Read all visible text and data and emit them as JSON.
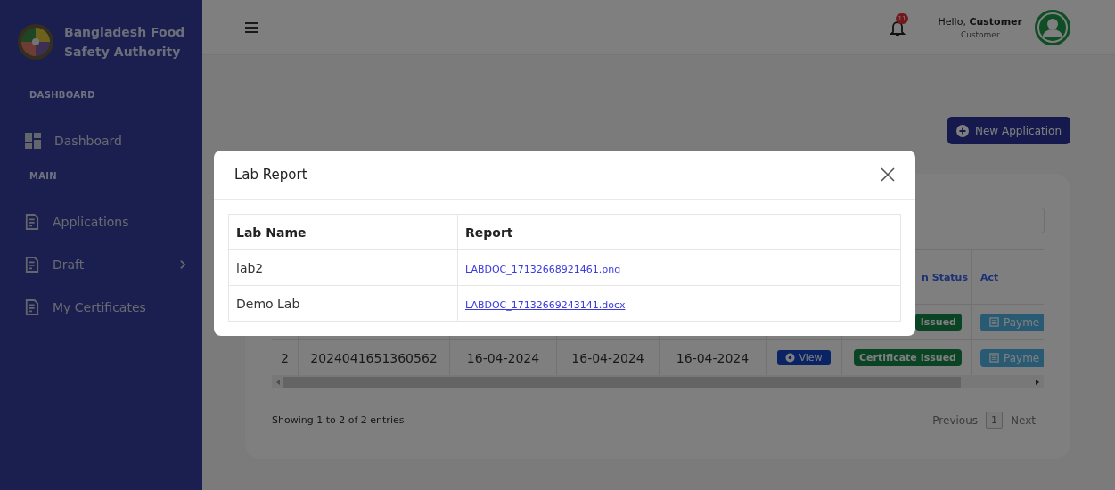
{
  "sidebar": {
    "brand": "Bangladesh Food Safety Authority",
    "sections": [
      {
        "heading": "DASHBOARD",
        "items": [
          {
            "label": "Dashboard",
            "kind": "grid",
            "has_submenu": false
          }
        ]
      },
      {
        "heading": "MAIN",
        "items": [
          {
            "label": "Applications",
            "kind": "document",
            "has_submenu": false
          },
          {
            "label": "Draft",
            "kind": "document",
            "has_submenu": true
          },
          {
            "label": "My Certificates",
            "kind": "document",
            "has_submenu": false
          }
        ]
      }
    ]
  },
  "topbar": {
    "notification_count": "11",
    "greeting": "Hello, **Customer**",
    "role": "Customer"
  },
  "new_application_button": "New Application",
  "applications_table": {
    "status_header": "n Status",
    "action_header": "Act",
    "rows": [
      {
        "status": "Issued",
        "action": "Payme"
      },
      {
        "serial": "2",
        "id": "2024041651360562",
        "dates": [
          "16-04-2024",
          "16-04-2024",
          "16-04-2024"
        ],
        "view": "View",
        "status": "Certificate Issued",
        "action": "Payme"
      }
    ]
  },
  "pagination": {
    "info": "Showing 1 to 2 of 2 entries",
    "previous": "Previous",
    "pages": [
      {
        "label": "1",
        "selected": true
      }
    ],
    "next": "Next"
  },
  "modal": {
    "title": "Lab Report",
    "columns": [
      "Lab Name",
      "Report"
    ],
    "rows": [
      {
        "lab": "lab2",
        "report": "LABDOC_17132668921461.png"
      },
      {
        "lab": "Demo Lab",
        "report": "LABDOC_17132669243141.docx"
      }
    ]
  }
}
